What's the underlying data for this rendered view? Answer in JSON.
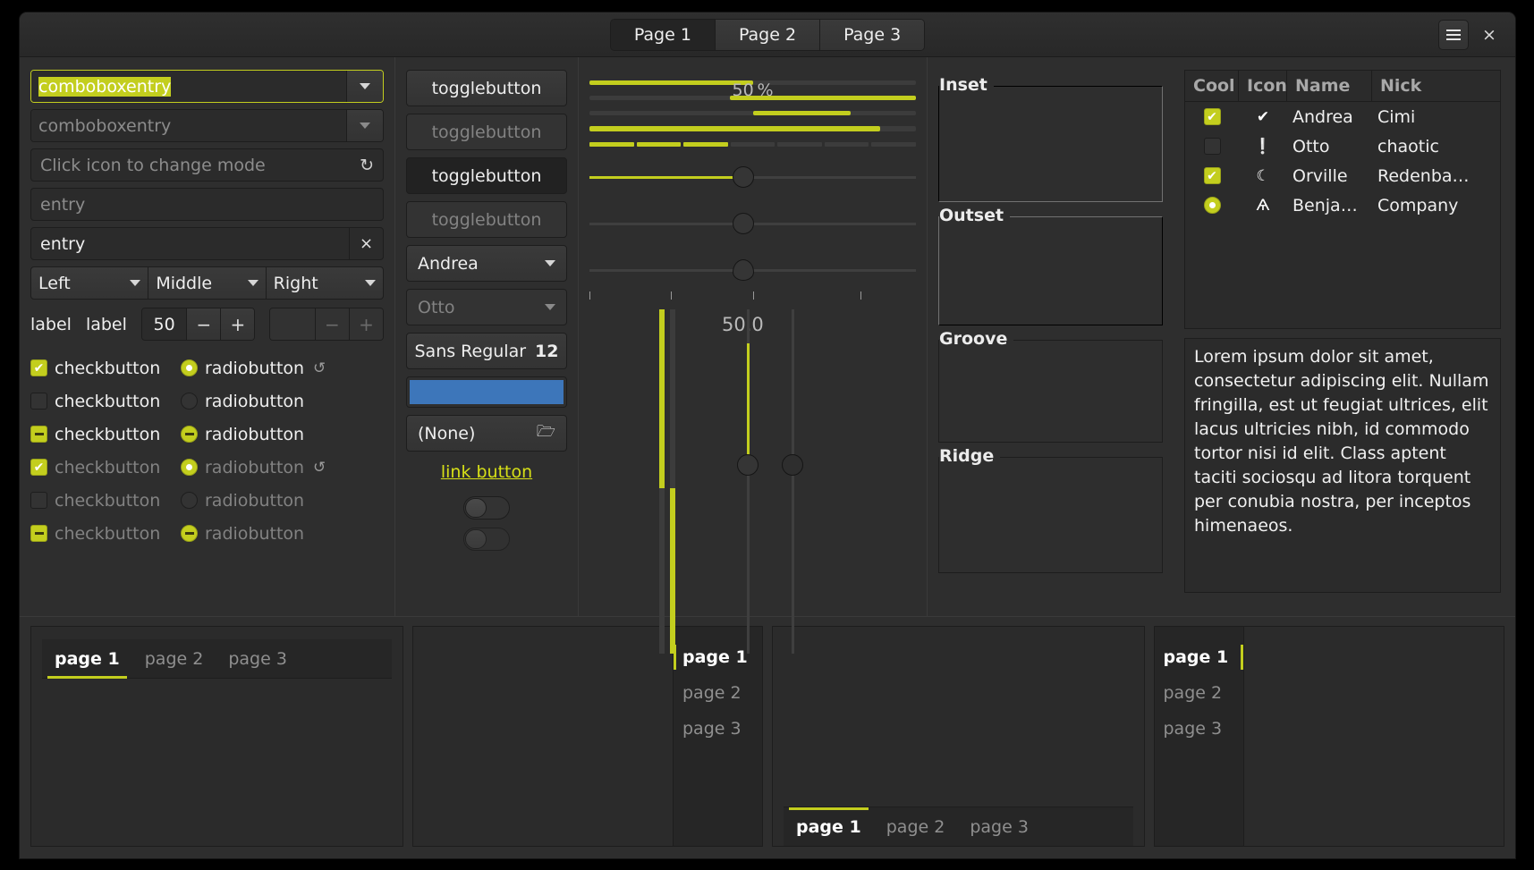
{
  "header": {
    "stack_switcher": [
      {
        "label": "Page 1",
        "active": true
      },
      {
        "label": "Page 2",
        "active": false
      },
      {
        "label": "Page 3",
        "active": false
      }
    ],
    "menu_icon": "hamburger-menu-icon",
    "close_icon": "×"
  },
  "entries": {
    "combo_focused_text": "comboboxentry",
    "combo_placeholder": "comboboxentry",
    "icon_entry_placeholder": "Click icon to change mode",
    "icon_entry_icon": "↻",
    "entry_placeholder": "entry",
    "entry_value": "entry",
    "entry_clear_icon": "×"
  },
  "combos": [
    {
      "label": "Left"
    },
    {
      "label": "Middle"
    },
    {
      "label": "Right"
    }
  ],
  "label_row": {
    "label_normal": "label",
    "label_dim": "label",
    "spin_value": "50",
    "spin_minus": "−",
    "spin_plus": "+",
    "spin_disabled_minus": "−",
    "spin_disabled_plus": "+"
  },
  "check_rows": [
    {
      "check_state": "on",
      "check_label": "checkbutton",
      "radio_state": "on",
      "radio_label": "radiobutton",
      "spinner": true,
      "dim": false
    },
    {
      "check_state": "off",
      "check_label": "checkbutton",
      "radio_state": "off",
      "radio_label": "radiobutton",
      "spinner": false,
      "dim": false
    },
    {
      "check_state": "mixed",
      "check_label": "checkbutton",
      "radio_state": "mixed",
      "radio_label": "radiobutton",
      "spinner": false,
      "dim": false
    },
    {
      "check_state": "on",
      "check_label": "checkbutton",
      "radio_state": "on",
      "radio_label": "radiobutton",
      "spinner": true,
      "dim": true
    },
    {
      "check_state": "off",
      "check_label": "checkbutton",
      "radio_state": "off",
      "radio_label": "radiobutton",
      "spinner": false,
      "dim": true
    },
    {
      "check_state": "mixed",
      "check_label": "checkbutton",
      "radio_state": "mixed",
      "radio_label": "radiobutton",
      "spinner": false,
      "dim": true
    }
  ],
  "buttons": {
    "toggle1": "togglebutton",
    "toggle2": "togglebutton",
    "toggle3": "togglebutton",
    "toggle4": "togglebutton",
    "combo_andrea": "Andrea",
    "combo_otto": "Otto",
    "font_name": "Sans Regular",
    "font_size": "12",
    "color_value": "#3d76ba",
    "file_label": "(None)",
    "file_icon": "὜1",
    "link_label": "link button"
  },
  "progress": {
    "bar1_pct": 50,
    "bar2_pct": 57,
    "percent_label": "50 %",
    "bar3_start_pct": 50,
    "bar3_len_pct": 30,
    "bar4_pct": 89,
    "levelbar_segments": 7,
    "levelbar_filled": 3,
    "scale1_value_pct": 47,
    "scale2_value_pct": 47,
    "scale3_value_pct": 47,
    "vertical_value_label": "50.0"
  },
  "frames": [
    {
      "title": "Inset"
    },
    {
      "title": "Outset"
    },
    {
      "title": "Groove"
    },
    {
      "title": "Ridge"
    }
  ],
  "treeview": {
    "columns": [
      "Cool",
      "Icon",
      "Name",
      "Nick"
    ],
    "rows": [
      {
        "cool": "on",
        "icon": "✔",
        "icon_name": "check-circle-icon",
        "name": "Andrea",
        "nick": "Cimi"
      },
      {
        "cool": "off",
        "icon": "❕",
        "icon_name": "warning-icon",
        "name": "Otto",
        "nick": "chaotic"
      },
      {
        "cool": "on",
        "icon": "☾",
        "icon_name": "moon-icon",
        "name": "Orville",
        "nick": "Redenba…"
      },
      {
        "cool": "radio",
        "icon": "Ѧ",
        "icon_name": "monkey-face-icon",
        "name": "Benja…",
        "nick": "Company"
      }
    ]
  },
  "textview": {
    "content": "Lorem ipsum dolor sit amet, consectetur adipiscing elit. Nullam fringilla, est ut feugiat ultrices, elit lacus ultricies nibh, id commodo tortor nisi id elit.\nClass aptent taciti sociosqu ad litora torquent per conubia nostra, per inceptos himenaeos."
  },
  "notebooks": [
    {
      "position": "top",
      "tabs": [
        {
          "label": "page 1",
          "active": true
        },
        {
          "label": "page 2",
          "active": false
        },
        {
          "label": "page 3",
          "active": false
        }
      ]
    },
    {
      "position": "right",
      "tabs": [
        {
          "label": "page 1",
          "active": true
        },
        {
          "label": "page 2",
          "active": false
        },
        {
          "label": "page 3",
          "active": false
        }
      ]
    },
    {
      "position": "bottom",
      "tabs": [
        {
          "label": "page 1",
          "active": true
        },
        {
          "label": "page 2",
          "active": false
        },
        {
          "label": "page 3",
          "active": false
        }
      ]
    },
    {
      "position": "left",
      "tabs": [
        {
          "label": "page 1",
          "active": true
        },
        {
          "label": "page 2",
          "active": false
        },
        {
          "label": "page 3",
          "active": false
        }
      ]
    }
  ],
  "colors": {
    "accent": "#c3ce1e",
    "bg": "#2e2e2e",
    "entry_bg": "#2b2b2b",
    "color_button": "#3d76ba"
  }
}
